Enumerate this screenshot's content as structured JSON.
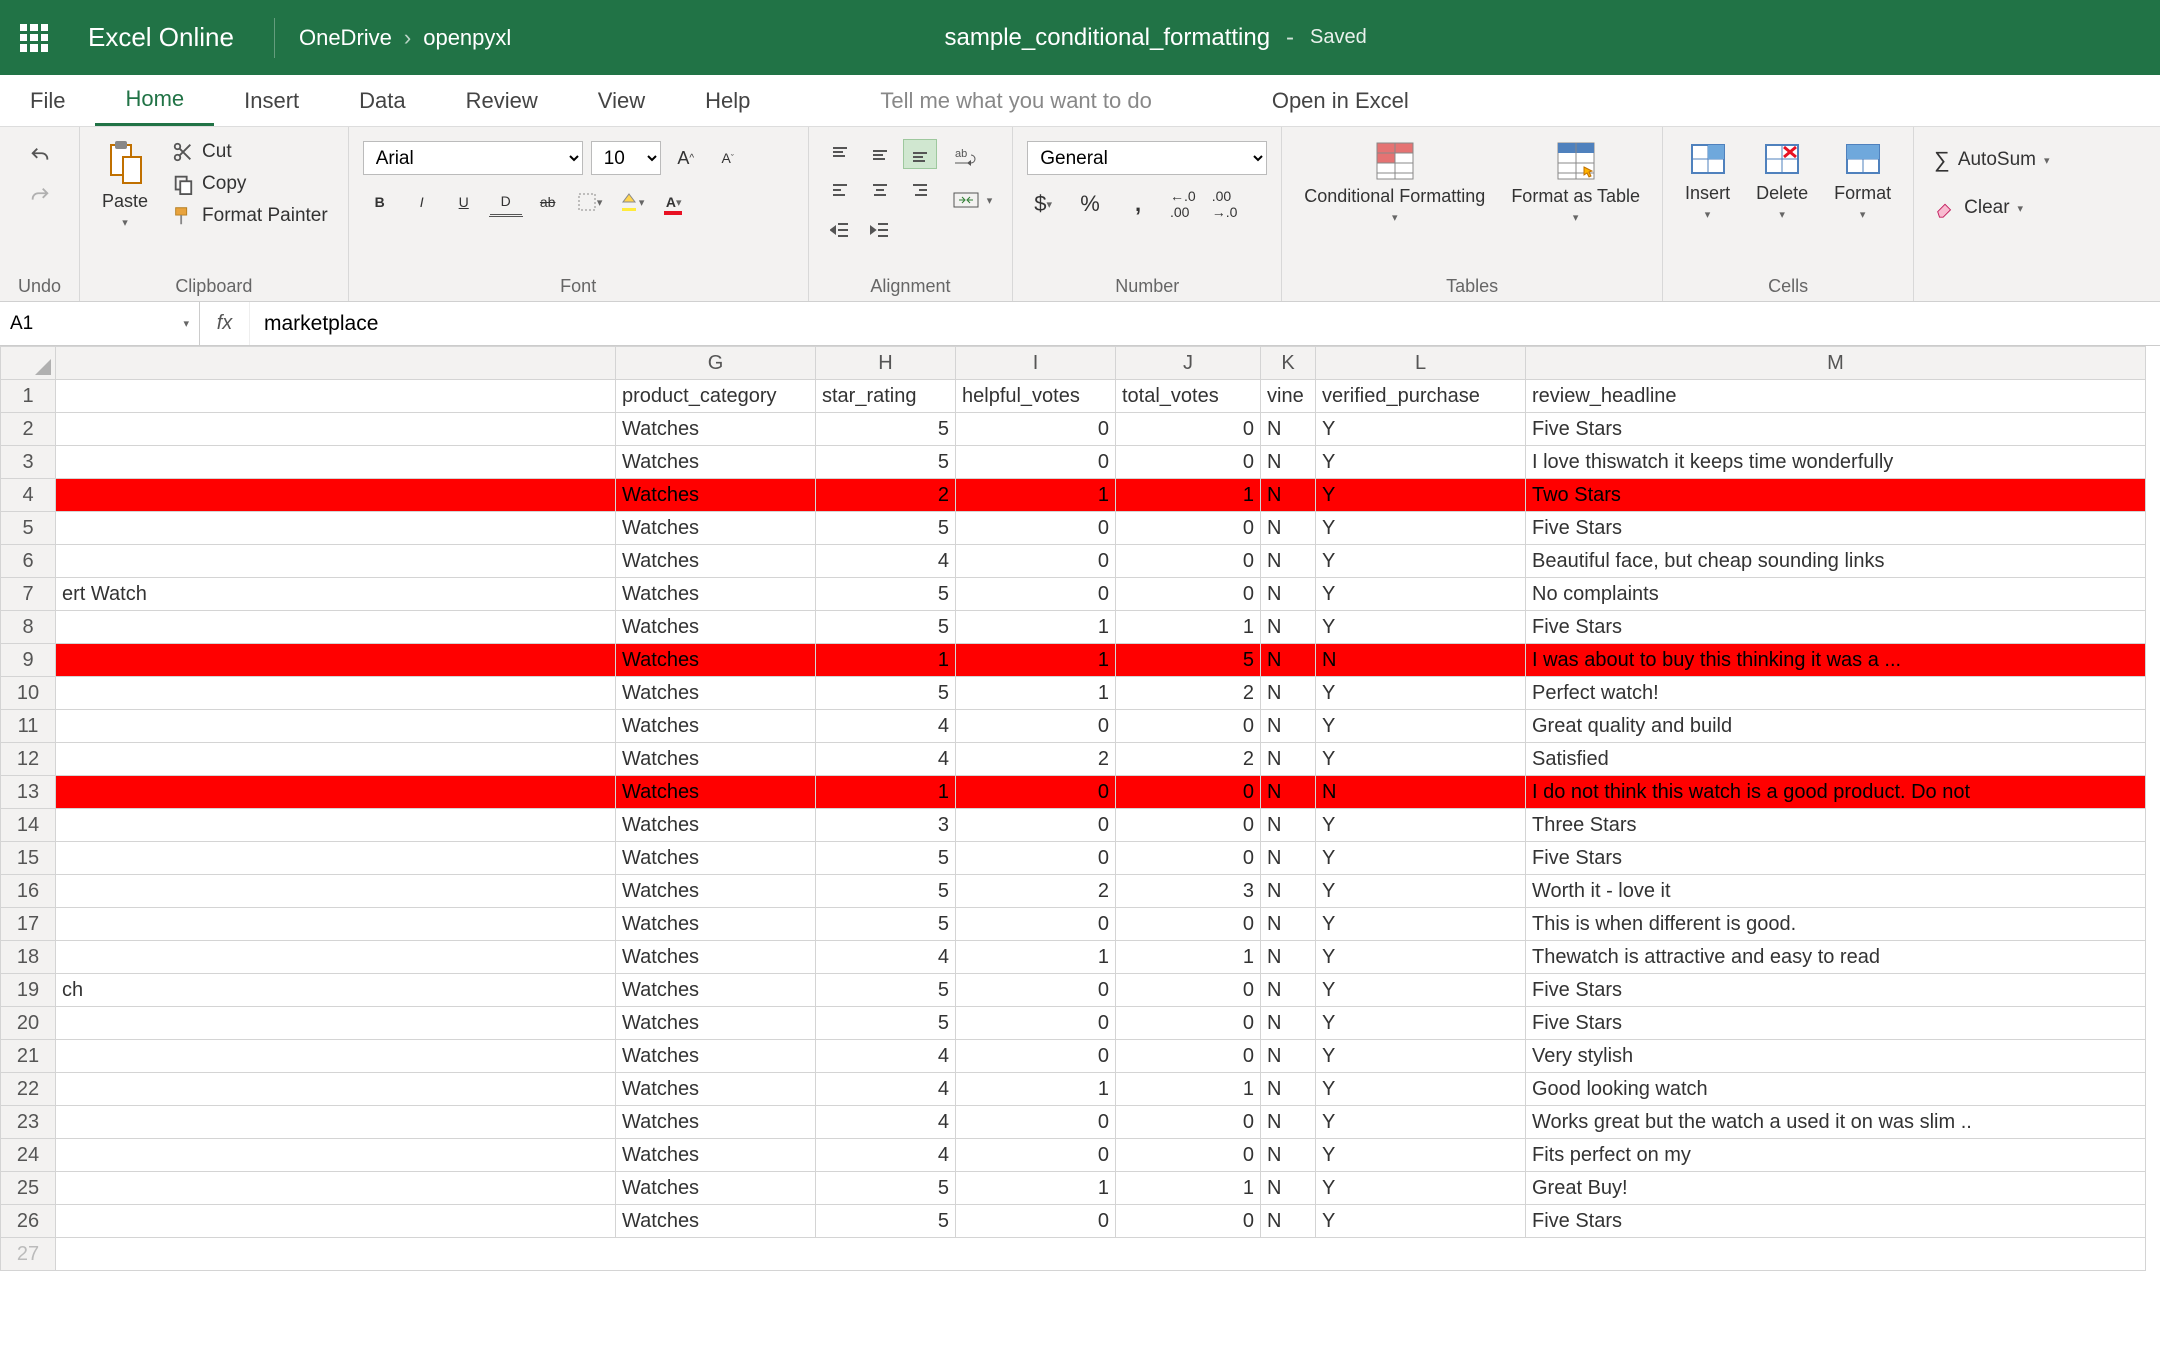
{
  "header": {
    "app_name": "Excel Online",
    "breadcrumb": [
      "OneDrive",
      "openpyxl"
    ],
    "doc_title": "sample_conditional_formatting",
    "saved_label": "Saved"
  },
  "tabs": {
    "items": [
      "File",
      "Home",
      "Insert",
      "Data",
      "Review",
      "View",
      "Help"
    ],
    "active": "Home",
    "tell_me": "Tell me what you want to do",
    "open_in_excel": "Open in Excel"
  },
  "ribbon": {
    "undo_label": "Undo",
    "paste_label": "Paste",
    "cut_label": "Cut",
    "copy_label": "Copy",
    "format_painter_label": "Format Painter",
    "clipboard_label": "Clipboard",
    "font_name": "Arial",
    "font_size": "10",
    "font_label": "Font",
    "alignment_label": "Alignment",
    "number_format": "General",
    "number_label": "Number",
    "cond_format_label": "Conditional Formatting",
    "format_table_label": "Format as Table",
    "tables_label": "Tables",
    "insert_label": "Insert",
    "delete_label": "Delete",
    "format_label": "Format",
    "cells_label": "Cells",
    "autosum_label": "AutoSum",
    "clear_label": "Clear"
  },
  "formula_bar": {
    "cell_ref": "A1",
    "formula": "marketplace"
  },
  "grid": {
    "columns": [
      "G",
      "H",
      "I",
      "J",
      "K",
      "L",
      "M"
    ],
    "headers": {
      "G": "product_category",
      "H": "star_rating",
      "I": "helpful_votes",
      "J": "total_votes",
      "K": "vine",
      "L": "verified_purchase",
      "M": "review_headline"
    },
    "partial_col_text": {
      "2": "",
      "7": "ert Watch",
      "19": "ch"
    },
    "rows": [
      {
        "n": 2,
        "G": "Watches",
        "H": 5,
        "I": 0,
        "J": 0,
        "K": "N",
        "L": "Y",
        "M": "Five Stars",
        "red": false
      },
      {
        "n": 3,
        "G": "Watches",
        "H": 5,
        "I": 0,
        "J": 0,
        "K": "N",
        "L": "Y",
        "M": "I love thiswatch it keeps time wonderfully",
        "red": false
      },
      {
        "n": 4,
        "G": "Watches",
        "H": 2,
        "I": 1,
        "J": 1,
        "K": "N",
        "L": "Y",
        "M": "Two Stars",
        "red": true
      },
      {
        "n": 5,
        "G": "Watches",
        "H": 5,
        "I": 0,
        "J": 0,
        "K": "N",
        "L": "Y",
        "M": "Five Stars",
        "red": false
      },
      {
        "n": 6,
        "G": "Watches",
        "H": 4,
        "I": 0,
        "J": 0,
        "K": "N",
        "L": "Y",
        "M": "Beautiful face, but cheap sounding links",
        "red": false
      },
      {
        "n": 7,
        "G": "Watches",
        "H": 5,
        "I": 0,
        "J": 0,
        "K": "N",
        "L": "Y",
        "M": "No complaints",
        "red": false
      },
      {
        "n": 8,
        "G": "Watches",
        "H": 5,
        "I": 1,
        "J": 1,
        "K": "N",
        "L": "Y",
        "M": "Five Stars",
        "red": false
      },
      {
        "n": 9,
        "G": "Watches",
        "H": 1,
        "I": 1,
        "J": 5,
        "K": "N",
        "L": "N",
        "M": "I was about to buy this thinking it was a ...",
        "red": true
      },
      {
        "n": 10,
        "G": "Watches",
        "H": 5,
        "I": 1,
        "J": 2,
        "K": "N",
        "L": "Y",
        "M": "Perfect watch!",
        "red": false
      },
      {
        "n": 11,
        "G": "Watches",
        "H": 4,
        "I": 0,
        "J": 0,
        "K": "N",
        "L": "Y",
        "M": "Great quality and build",
        "red": false
      },
      {
        "n": 12,
        "G": "Watches",
        "H": 4,
        "I": 2,
        "J": 2,
        "K": "N",
        "L": "Y",
        "M": "Satisfied",
        "red": false
      },
      {
        "n": 13,
        "G": "Watches",
        "H": 1,
        "I": 0,
        "J": 0,
        "K": "N",
        "L": "N",
        "M": "I do not think this watch is a good product. Do not",
        "red": true
      },
      {
        "n": 14,
        "G": "Watches",
        "H": 3,
        "I": 0,
        "J": 0,
        "K": "N",
        "L": "Y",
        "M": "Three Stars",
        "red": false
      },
      {
        "n": 15,
        "G": "Watches",
        "H": 5,
        "I": 0,
        "J": 0,
        "K": "N",
        "L": "Y",
        "M": "Five Stars",
        "red": false
      },
      {
        "n": 16,
        "G": "Watches",
        "H": 5,
        "I": 2,
        "J": 3,
        "K": "N",
        "L": "Y",
        "M": "Worth it - love it",
        "red": false
      },
      {
        "n": 17,
        "G": "Watches",
        "H": 5,
        "I": 0,
        "J": 0,
        "K": "N",
        "L": "Y",
        "M": "This is when different is good.",
        "red": false
      },
      {
        "n": 18,
        "G": "Watches",
        "H": 4,
        "I": 1,
        "J": 1,
        "K": "N",
        "L": "Y",
        "M": "Thewatch is attractive and easy to read",
        "red": false
      },
      {
        "n": 19,
        "G": "Watches",
        "H": 5,
        "I": 0,
        "J": 0,
        "K": "N",
        "L": "Y",
        "M": "Five Stars",
        "red": false
      },
      {
        "n": 20,
        "G": "Watches",
        "H": 5,
        "I": 0,
        "J": 0,
        "K": "N",
        "L": "Y",
        "M": "Five Stars",
        "red": false
      },
      {
        "n": 21,
        "G": "Watches",
        "H": 4,
        "I": 0,
        "J": 0,
        "K": "N",
        "L": "Y",
        "M": "Very stylish",
        "red": false
      },
      {
        "n": 22,
        "G": "Watches",
        "H": 4,
        "I": 1,
        "J": 1,
        "K": "N",
        "L": "Y",
        "M": "Good looking watch",
        "red": false
      },
      {
        "n": 23,
        "G": "Watches",
        "H": 4,
        "I": 0,
        "J": 0,
        "K": "N",
        "L": "Y",
        "M": "Works great but the watch a used it on was slim ..",
        "red": false
      },
      {
        "n": 24,
        "G": "Watches",
        "H": 4,
        "I": 0,
        "J": 0,
        "K": "N",
        "L": "Y",
        "M": "Fits perfect on my",
        "red": false
      },
      {
        "n": 25,
        "G": "Watches",
        "H": 5,
        "I": 1,
        "J": 1,
        "K": "N",
        "L": "Y",
        "M": "Great Buy!",
        "red": false
      },
      {
        "n": 26,
        "G": "Watches",
        "H": 5,
        "I": 0,
        "J": 0,
        "K": "N",
        "L": "Y",
        "M": "Five Stars",
        "red": false
      }
    ]
  }
}
